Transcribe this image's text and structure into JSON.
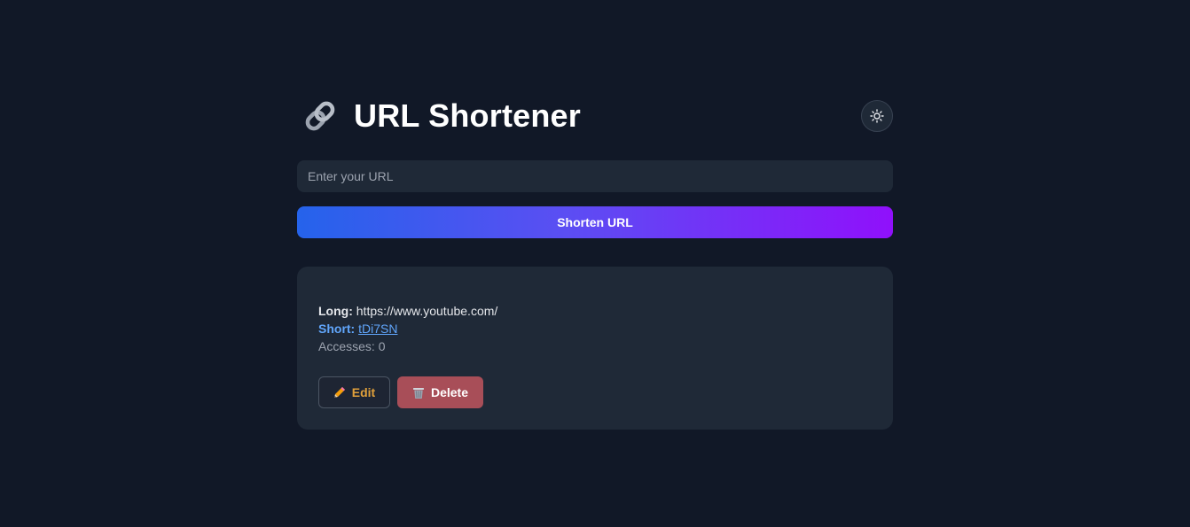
{
  "header": {
    "title": "URL Shortener",
    "title_icon": "link-icon",
    "theme_toggle_icon": "sun-icon"
  },
  "form": {
    "url_placeholder": "Enter your URL",
    "url_value": "",
    "submit_label": "Shorten URL"
  },
  "links": [
    {
      "long_label": "Long:",
      "long_url": "https://www.youtube.com/",
      "short_label": "Short:",
      "short_code": "tDi7SN",
      "accesses_label": "Accesses:",
      "accesses": "0",
      "edit_label": "Edit",
      "edit_icon": "pencil-icon",
      "delete_label": "Delete",
      "delete_icon": "trash-icon"
    }
  ],
  "colors": {
    "background": "#111827",
    "surface": "#1f2937",
    "accent_blue": "#60a5fa",
    "gradient_start": "#2563eb",
    "gradient_end": "#9010fb",
    "edit_text": "#e0a03b",
    "delete_bg": "#a84e58"
  }
}
